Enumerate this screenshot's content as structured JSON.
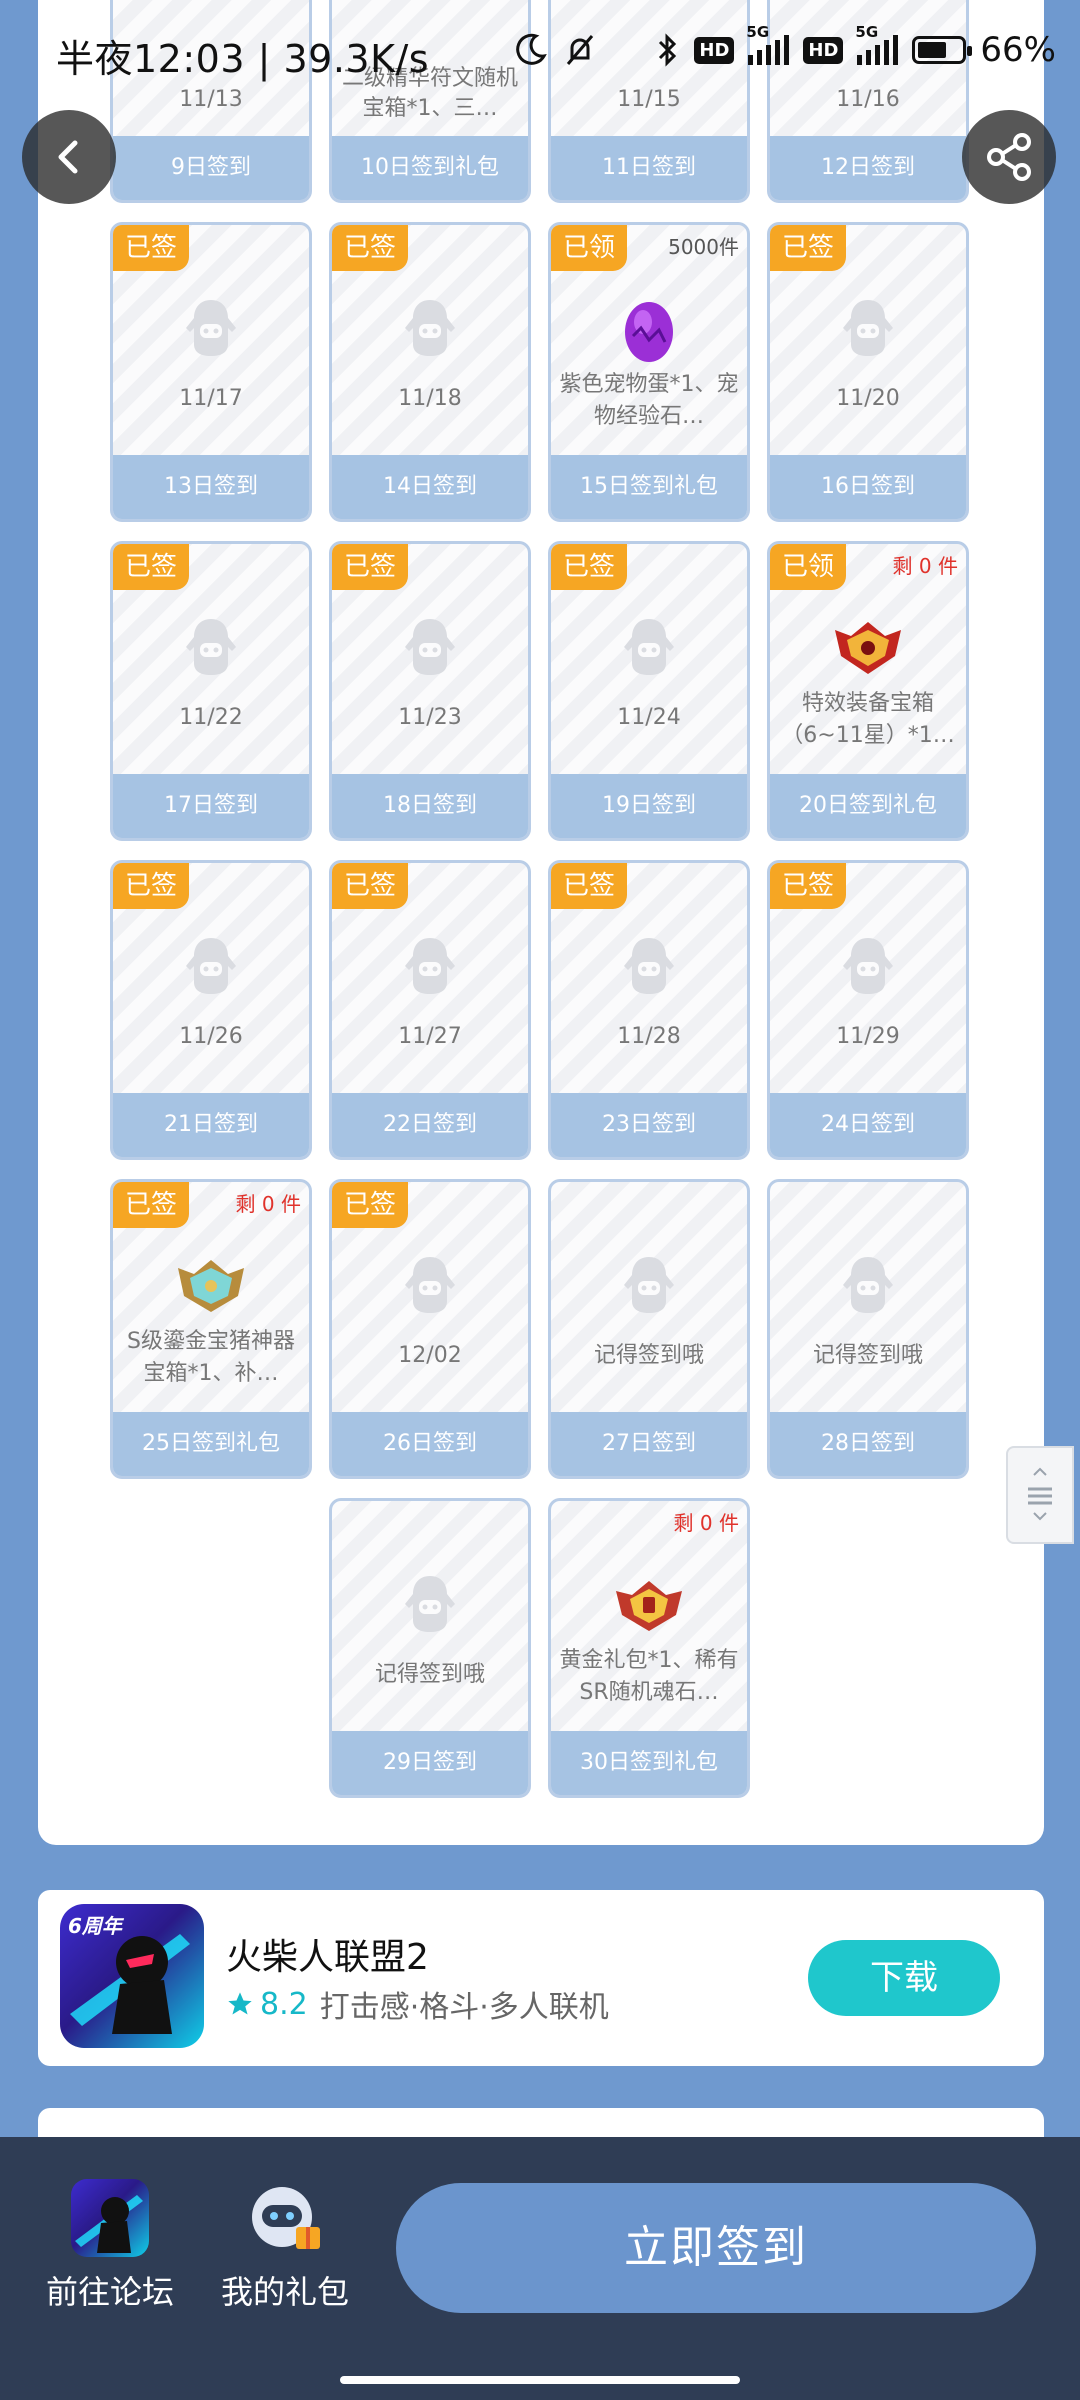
{
  "status": {
    "time": "半夜12:03 | 39.3K/s",
    "battery": "66%",
    "battery_level": 0.66,
    "hd": "HD",
    "net": "5G"
  },
  "nav": {
    "back_icon": "back-arrow-icon",
    "share_icon": "share-icon"
  },
  "top_row": [
    {
      "date": "11/13",
      "label": "9日签到"
    },
    {
      "date": "二级精华符文随机宝箱*1、三…",
      "label": "10日签到礼包"
    },
    {
      "date": "11/15",
      "label": "11日签到"
    },
    {
      "date": "11/16",
      "label": "12日签到"
    }
  ],
  "cards": [
    {
      "badge": "已签",
      "stock": "",
      "sub": "11/17",
      "label": "13日签到",
      "icon": "placeholder-avatar-icon"
    },
    {
      "badge": "已签",
      "stock": "",
      "sub": "11/18",
      "label": "14日签到",
      "icon": "placeholder-avatar-icon"
    },
    {
      "badge": "已领",
      "stock": "5000件",
      "sub": "紫色宠物蛋*1、宠物经验石…",
      "label": "15日签到礼包",
      "icon": "purple-egg-icon"
    },
    {
      "badge": "已签",
      "stock": "",
      "sub": "11/20",
      "label": "16日签到",
      "icon": "placeholder-avatar-icon"
    },
    {
      "badge": "已签",
      "stock": "",
      "sub": "11/22",
      "label": "17日签到",
      "icon": "placeholder-avatar-icon"
    },
    {
      "badge": "已签",
      "stock": "",
      "sub": "11/23",
      "label": "18日签到",
      "icon": "placeholder-avatar-icon"
    },
    {
      "badge": "已签",
      "stock": "",
      "sub": "11/24",
      "label": "19日签到",
      "icon": "placeholder-avatar-icon"
    },
    {
      "badge": "已领",
      "stock": "剩 0 件",
      "sub": "特效装备宝箱（6~11星）*1…",
      "label": "20日签到礼包",
      "icon": "red-chest-icon"
    },
    {
      "badge": "已签",
      "stock": "",
      "sub": "11/26",
      "label": "21日签到",
      "icon": "placeholder-avatar-icon"
    },
    {
      "badge": "已签",
      "stock": "",
      "sub": "11/27",
      "label": "22日签到",
      "icon": "placeholder-avatar-icon"
    },
    {
      "badge": "已签",
      "stock": "",
      "sub": "11/28",
      "label": "23日签到",
      "icon": "placeholder-avatar-icon"
    },
    {
      "badge": "已签",
      "stock": "",
      "sub": "11/29",
      "label": "24日签到",
      "icon": "placeholder-avatar-icon"
    },
    {
      "badge": "已签",
      "stock": "剩 0 件",
      "sub": "S级鎏金宝猪神器宝箱*1、补…",
      "label": "25日签到礼包",
      "icon": "gold-chest-icon"
    },
    {
      "badge": "已签",
      "stock": "",
      "sub": "12/02",
      "label": "26日签到",
      "icon": "placeholder-avatar-icon"
    },
    {
      "badge": "",
      "stock": "",
      "sub": "记得签到哦",
      "label": "27日签到",
      "icon": "placeholder-avatar-icon"
    },
    {
      "badge": "",
      "stock": "",
      "sub": "记得签到哦",
      "label": "28日签到",
      "icon": "placeholder-avatar-icon"
    },
    {
      "badge": "",
      "stock": "",
      "sub": "记得签到哦",
      "label": "29日签到",
      "icon": "placeholder-avatar-icon"
    },
    {
      "badge": "",
      "stock": "剩 0 件",
      "sub": "黄金礼包*1、稀有SR随机魂石…",
      "label": "30日签到礼包",
      "icon": "gold-gift-icon"
    }
  ],
  "app": {
    "name": "火柴人联盟2",
    "rating": "8.2",
    "tags": "打击感·格斗·多人联机",
    "download": "下载",
    "badge": "6周年"
  },
  "bottom": {
    "forum": "前往论坛",
    "gifts": "我的礼包",
    "sign_now": "立即签到"
  },
  "colors": {
    "badge_orange": "#f6a623",
    "card_footer": "#a6c3e3",
    "page_bg": "#6f99cf",
    "download": "#1fc7cc",
    "bottom_bar": "#2f3d55"
  }
}
